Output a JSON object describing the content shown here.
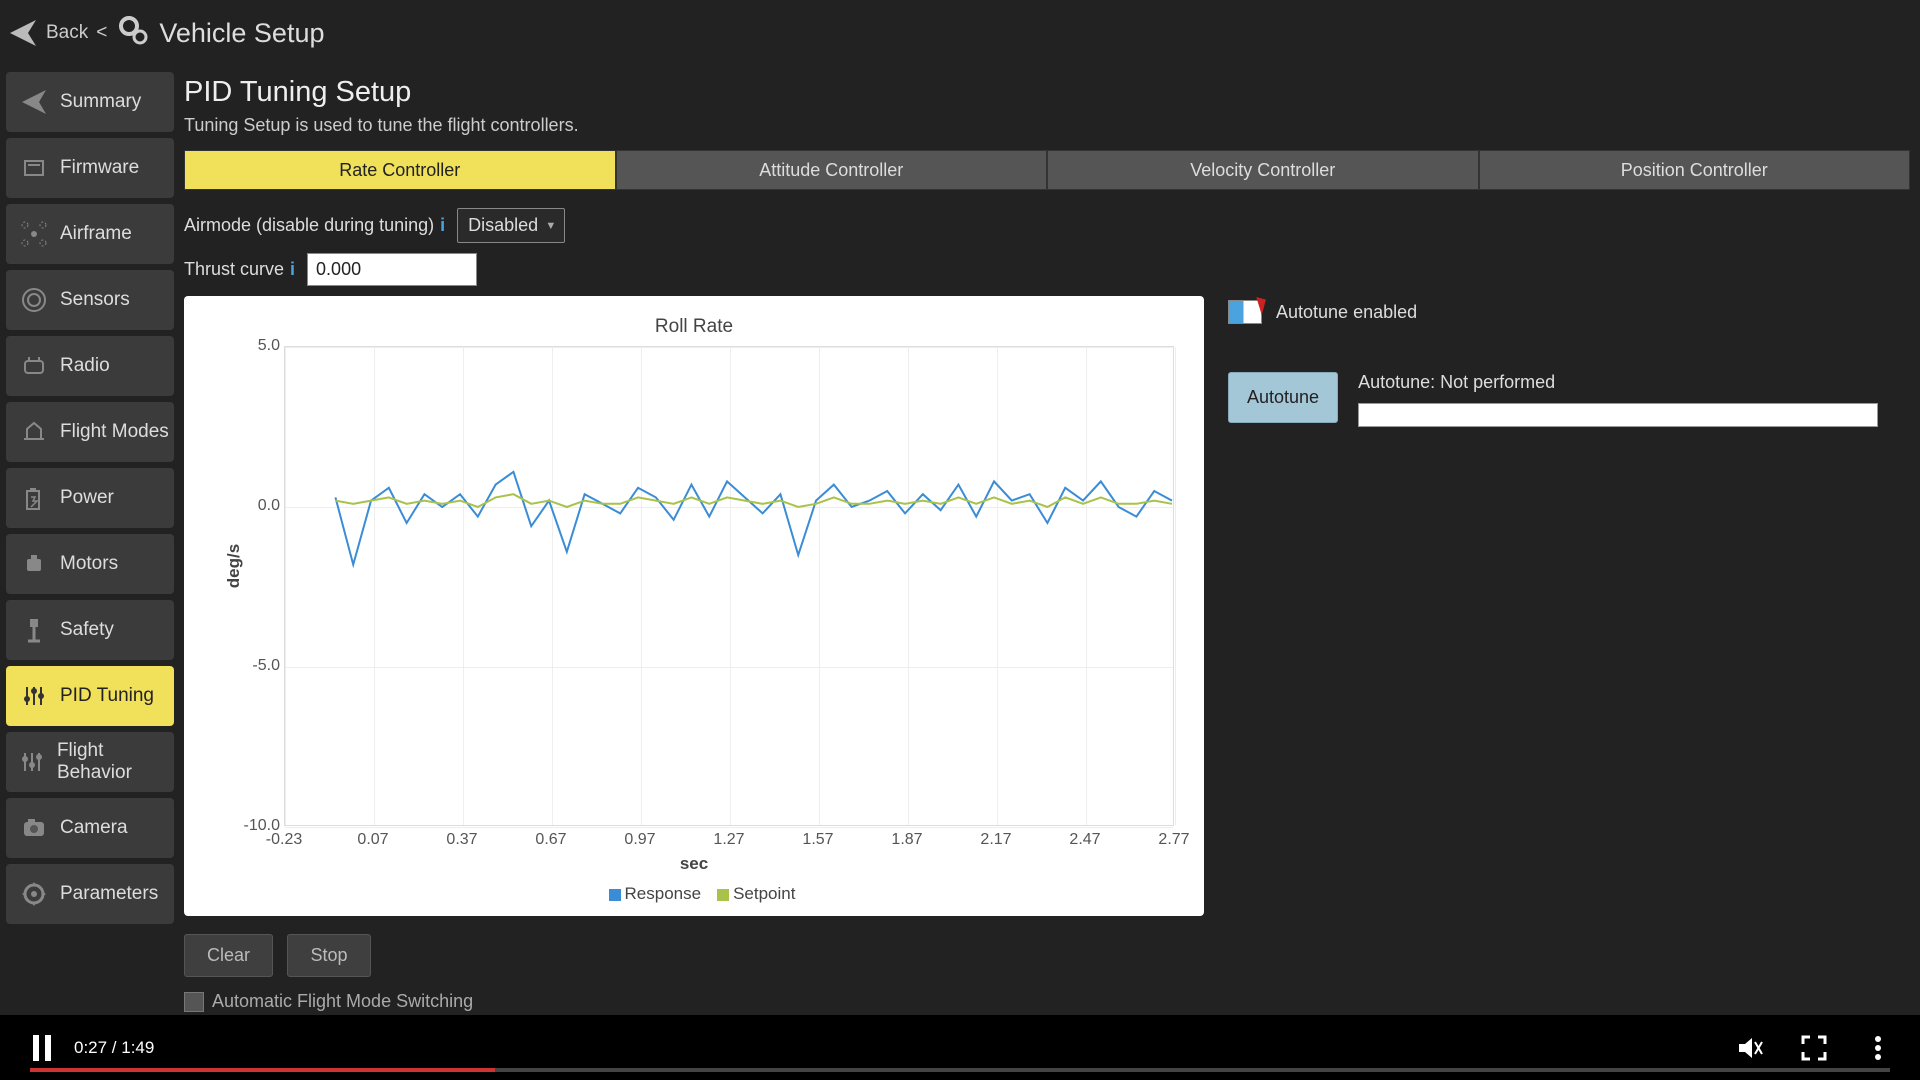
{
  "header": {
    "back": "Back",
    "title": "Vehicle Setup"
  },
  "sidebar": {
    "items": [
      {
        "label": "Summary"
      },
      {
        "label": "Firmware"
      },
      {
        "label": "Airframe"
      },
      {
        "label": "Sensors"
      },
      {
        "label": "Radio"
      },
      {
        "label": "Flight Modes"
      },
      {
        "label": "Power"
      },
      {
        "label": "Motors"
      },
      {
        "label": "Safety"
      },
      {
        "label": "PID Tuning"
      },
      {
        "label": "Flight Behavior"
      },
      {
        "label": "Camera"
      },
      {
        "label": "Parameters"
      }
    ],
    "active_index": 9
  },
  "page": {
    "title": "PID Tuning Setup",
    "subtitle": "Tuning Setup is used to tune the flight controllers."
  },
  "tabs": {
    "items": [
      "Rate Controller",
      "Attitude Controller",
      "Velocity Controller",
      "Position Controller"
    ],
    "active_index": 0
  },
  "form": {
    "airmode_label": "Airmode (disable during tuning)",
    "airmode_value": "Disabled",
    "thrust_label": "Thrust curve",
    "thrust_value": "0.000"
  },
  "autotune": {
    "enabled_label": "Autotune enabled",
    "button": "Autotune",
    "status": "Autotune: Not performed"
  },
  "buttons": {
    "clear": "Clear",
    "stop": "Stop"
  },
  "auto_switch_label": "Automatic Flight Mode Switching",
  "video": {
    "time": "0:27 / 1:49"
  },
  "chart_data": {
    "type": "line",
    "title": "Roll Rate",
    "xlabel": "sec",
    "ylabel": "deg/s",
    "xlim": [
      -0.23,
      2.77
    ],
    "ylim": [
      -10.0,
      5.0
    ],
    "xticks": [
      -0.23,
      0.07,
      0.37,
      0.67,
      0.97,
      1.27,
      1.57,
      1.87,
      2.17,
      2.47,
      2.77
    ],
    "yticks": [
      5.0,
      0.0,
      -5.0,
      -10.0
    ],
    "x": [
      -0.06,
      0.0,
      0.06,
      0.12,
      0.18,
      0.24,
      0.3,
      0.36,
      0.42,
      0.48,
      0.54,
      0.6,
      0.66,
      0.72,
      0.78,
      0.84,
      0.9,
      0.96,
      1.02,
      1.08,
      1.14,
      1.2,
      1.26,
      1.32,
      1.38,
      1.44,
      1.5,
      1.56,
      1.62,
      1.68,
      1.74,
      1.8,
      1.86,
      1.92,
      1.98,
      2.04,
      2.1,
      2.16,
      2.22,
      2.28,
      2.34,
      2.4,
      2.46,
      2.52,
      2.58,
      2.64,
      2.7,
      2.76
    ],
    "series": [
      {
        "name": "Response",
        "color": "#3a8cd6",
        "values": [
          0.3,
          -1.8,
          0.2,
          0.6,
          -0.5,
          0.4,
          0.0,
          0.4,
          -0.3,
          0.7,
          1.1,
          -0.6,
          0.2,
          -1.4,
          0.4,
          0.1,
          -0.2,
          0.6,
          0.3,
          -0.4,
          0.7,
          -0.3,
          0.8,
          0.3,
          -0.2,
          0.4,
          -1.5,
          0.2,
          0.7,
          0.0,
          0.2,
          0.5,
          -0.2,
          0.4,
          -0.1,
          0.7,
          -0.3,
          0.8,
          0.2,
          0.4,
          -0.5,
          0.6,
          0.2,
          0.8,
          0.0,
          -0.3,
          0.5,
          0.2
        ]
      },
      {
        "name": "Setpoint",
        "color": "#a8c24a",
        "values": [
          0.2,
          0.1,
          0.2,
          0.3,
          0.1,
          0.2,
          0.1,
          0.2,
          0.0,
          0.3,
          0.4,
          0.1,
          0.2,
          0.0,
          0.2,
          0.1,
          0.1,
          0.3,
          0.2,
          0.1,
          0.3,
          0.1,
          0.3,
          0.2,
          0.1,
          0.2,
          0.0,
          0.1,
          0.3,
          0.1,
          0.1,
          0.2,
          0.1,
          0.2,
          0.1,
          0.3,
          0.1,
          0.3,
          0.1,
          0.2,
          0.0,
          0.3,
          0.1,
          0.3,
          0.1,
          0.1,
          0.2,
          0.1
        ]
      }
    ],
    "legend": [
      "Response",
      "Setpoint"
    ]
  }
}
